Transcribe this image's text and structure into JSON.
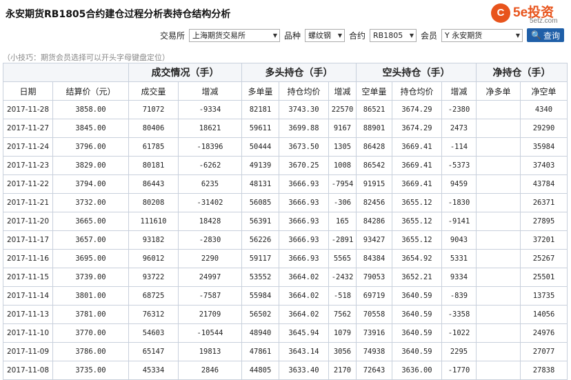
{
  "page_title": "永安期货RB1805合约建仓过程分析表持仓结构分析",
  "logo": {
    "mark": "C",
    "brand": "5e投资",
    "domain": "5etz.com"
  },
  "filters": {
    "exchange_label": "交易所",
    "exchange_value": "上海期货交易所",
    "product_label": "品种",
    "product_value": "螺纹钢",
    "contract_label": "合约",
    "contract_value": "RB1805",
    "member_label": "会员",
    "member_value": "Y 永安期货",
    "query_label": "查询"
  },
  "tip": "（小技巧：期货会员选择可以开头字母键盘定位）",
  "groups": [
    "成交情况（手）",
    "多头持仓（手）",
    "空头持仓（手）",
    "净持仓（手）"
  ],
  "columns": [
    "日期",
    "结算价（元）",
    "成交量",
    "增减",
    "多单量",
    "持仓均价",
    "增减",
    "空单量",
    "持仓均价",
    "增减",
    "净多单",
    "净空单"
  ],
  "rows": [
    {
      "date": "2017-11-28",
      "settle": "3858.00",
      "vol": "71072",
      "vol_chg": "-9334",
      "long": "82181",
      "long_avg": "3743.30",
      "long_chg": "22570",
      "short": "86521",
      "short_avg": "3674.29",
      "short_chg": "-2380",
      "net_long": "",
      "net_short": "4340"
    },
    {
      "date": "2017-11-27",
      "settle": "3845.00",
      "vol": "80406",
      "vol_chg": "18621",
      "long": "59611",
      "long_avg": "3699.88",
      "long_chg": "9167",
      "short": "88901",
      "short_avg": "3674.29",
      "short_chg": "2473",
      "net_long": "",
      "net_short": "29290"
    },
    {
      "date": "2017-11-24",
      "settle": "3796.00",
      "vol": "61785",
      "vol_chg": "-18396",
      "long": "50444",
      "long_avg": "3673.50",
      "long_chg": "1305",
      "short": "86428",
      "short_avg": "3669.41",
      "short_chg": "-114",
      "net_long": "",
      "net_short": "35984"
    },
    {
      "date": "2017-11-23",
      "settle": "3829.00",
      "vol": "80181",
      "vol_chg": "-6262",
      "long": "49139",
      "long_avg": "3670.25",
      "long_chg": "1008",
      "short": "86542",
      "short_avg": "3669.41",
      "short_chg": "-5373",
      "net_long": "",
      "net_short": "37403"
    },
    {
      "date": "2017-11-22",
      "settle": "3794.00",
      "vol": "86443",
      "vol_chg": "6235",
      "long": "48131",
      "long_avg": "3666.93",
      "long_chg": "-7954",
      "short": "91915",
      "short_avg": "3669.41",
      "short_chg": "9459",
      "net_long": "",
      "net_short": "43784"
    },
    {
      "date": "2017-11-21",
      "settle": "3732.00",
      "vol": "80208",
      "vol_chg": "-31402",
      "long": "56085",
      "long_avg": "3666.93",
      "long_chg": "-306",
      "short": "82456",
      "short_avg": "3655.12",
      "short_chg": "-1830",
      "net_long": "",
      "net_short": "26371"
    },
    {
      "date": "2017-11-20",
      "settle": "3665.00",
      "vol": "111610",
      "vol_chg": "18428",
      "long": "56391",
      "long_avg": "3666.93",
      "long_chg": "165",
      "short": "84286",
      "short_avg": "3655.12",
      "short_chg": "-9141",
      "net_long": "",
      "net_short": "27895"
    },
    {
      "date": "2017-11-17",
      "settle": "3657.00",
      "vol": "93182",
      "vol_chg": "-2830",
      "long": "56226",
      "long_avg": "3666.93",
      "long_chg": "-2891",
      "short": "93427",
      "short_avg": "3655.12",
      "short_chg": "9043",
      "net_long": "",
      "net_short": "37201"
    },
    {
      "date": "2017-11-16",
      "settle": "3695.00",
      "vol": "96012",
      "vol_chg": "2290",
      "long": "59117",
      "long_avg": "3666.93",
      "long_chg": "5565",
      "short": "84384",
      "short_avg": "3654.92",
      "short_chg": "5331",
      "net_long": "",
      "net_short": "25267"
    },
    {
      "date": "2017-11-15",
      "settle": "3739.00",
      "vol": "93722",
      "vol_chg": "24997",
      "long": "53552",
      "long_avg": "3664.02",
      "long_chg": "-2432",
      "short": "79053",
      "short_avg": "3652.21",
      "short_chg": "9334",
      "net_long": "",
      "net_short": "25501"
    },
    {
      "date": "2017-11-14",
      "settle": "3801.00",
      "vol": "68725",
      "vol_chg": "-7587",
      "long": "55984",
      "long_avg": "3664.02",
      "long_chg": "-518",
      "short": "69719",
      "short_avg": "3640.59",
      "short_chg": "-839",
      "net_long": "",
      "net_short": "13735"
    },
    {
      "date": "2017-11-13",
      "settle": "3781.00",
      "vol": "76312",
      "vol_chg": "21709",
      "long": "56502",
      "long_avg": "3664.02",
      "long_chg": "7562",
      "short": "70558",
      "short_avg": "3640.59",
      "short_chg": "-3358",
      "net_long": "",
      "net_short": "14056"
    },
    {
      "date": "2017-11-10",
      "settle": "3770.00",
      "vol": "54603",
      "vol_chg": "-10544",
      "long": "48940",
      "long_avg": "3645.94",
      "long_chg": "1079",
      "short": "73916",
      "short_avg": "3640.59",
      "short_chg": "-1022",
      "net_long": "",
      "net_short": "24976"
    },
    {
      "date": "2017-11-09",
      "settle": "3786.00",
      "vol": "65147",
      "vol_chg": "19813",
      "long": "47861",
      "long_avg": "3643.14",
      "long_chg": "3056",
      "short": "74938",
      "short_avg": "3640.59",
      "short_chg": "2295",
      "net_long": "",
      "net_short": "27077"
    },
    {
      "date": "2017-11-08",
      "settle": "3735.00",
      "vol": "45334",
      "vol_chg": "2846",
      "long": "44805",
      "long_avg": "3633.40",
      "long_chg": "2170",
      "short": "72643",
      "short_avg": "3636.00",
      "short_chg": "-1770",
      "net_long": "",
      "net_short": "27838"
    }
  ],
  "colors": {
    "positive": "#d9000d",
    "negative": "#1a8a1a",
    "accent": "#1f5fa8",
    "brand": "#e8541c"
  }
}
